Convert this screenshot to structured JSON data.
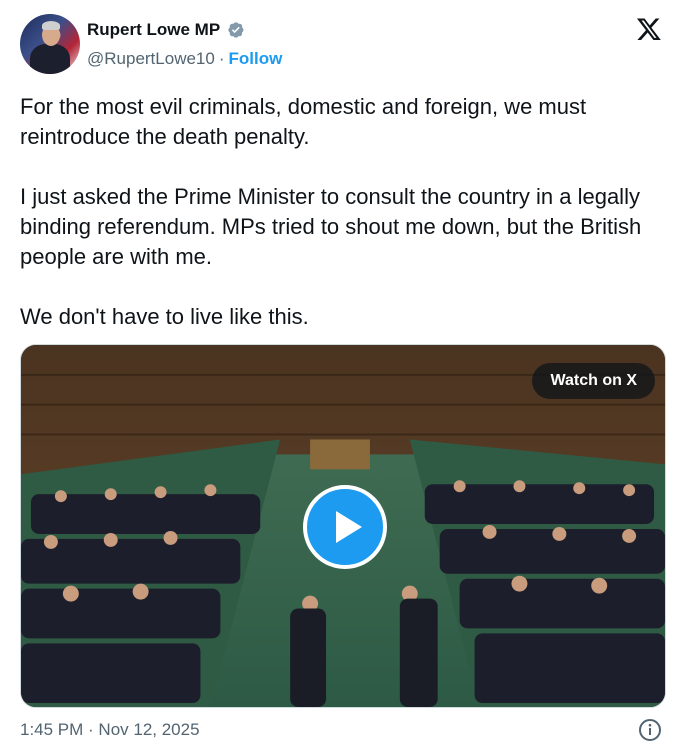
{
  "author": {
    "display_name": "Rupert Lowe MP",
    "handle": "@RupertLowe10",
    "separator": "·",
    "follow_label": "Follow",
    "verified_icon": "verified-badge-icon"
  },
  "tweet": {
    "text": "For the most evil criminals, domestic and foreign, we must reintroduce the death penalty.\n\nI just asked the Prime Minister to consult the country in a legally binding referendum. MPs tried to shout me down, but the British people are with me.\n\nWe don't have to live like this."
  },
  "media": {
    "type": "video",
    "watch_label": "Watch on X",
    "play_icon": "play-icon"
  },
  "footer": {
    "timestamp": "1:45 PM · Nov 12, 2025",
    "info_icon": "info-icon"
  },
  "colors": {
    "accent": "#1d9bf0",
    "text_primary": "#0f1419",
    "text_secondary": "#536471"
  }
}
